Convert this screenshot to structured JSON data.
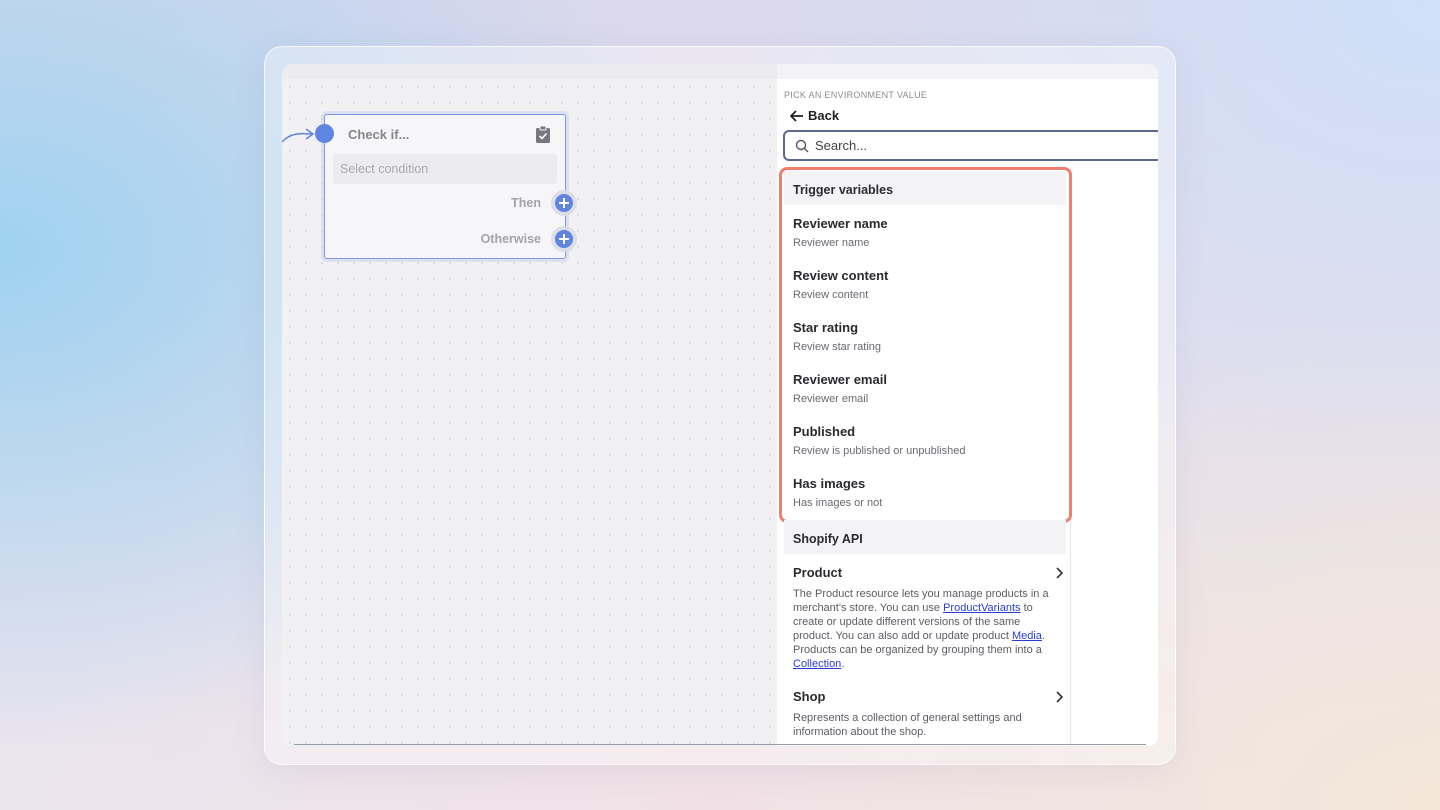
{
  "node": {
    "title": "Check if...",
    "condition_placeholder": "Select condition",
    "then_label": "Then",
    "otherwise_label": "Otherwise"
  },
  "panel": {
    "header": "PICK AN ENVIRONMENT VALUE",
    "back_label": "Back",
    "search_placeholder": "Search...",
    "trigger_section": "Trigger variables",
    "trigger_items": [
      {
        "name": "Reviewer name",
        "desc": "Reviewer name"
      },
      {
        "name": "Review content",
        "desc": "Review content"
      },
      {
        "name": "Star rating",
        "desc": "Review star rating"
      },
      {
        "name": "Reviewer email",
        "desc": "Reviewer email"
      },
      {
        "name": "Published",
        "desc": "Review is published or unpublished"
      },
      {
        "name": "Has images",
        "desc": "Has images or not"
      }
    ],
    "api_section": "Shopify API",
    "api_items": [
      {
        "name": "Product",
        "desc_1": "The Product resource lets you manage products in a merchant's store. You can use ",
        "link_1": "ProductVariants",
        "desc_2": " to create or update different versions of the same product. You can also add or update product ",
        "link_2": "Media",
        "desc_3": ". Products can be organized by grouping them into a ",
        "link_3": "Collection",
        "desc_4": "."
      },
      {
        "name": "Shop",
        "desc": "Represents a collection of general settings and information about the shop."
      }
    ]
  },
  "colors": {
    "accent": "#5f85e0",
    "highlight": "#ef8070",
    "link": "#2a3fd0"
  }
}
